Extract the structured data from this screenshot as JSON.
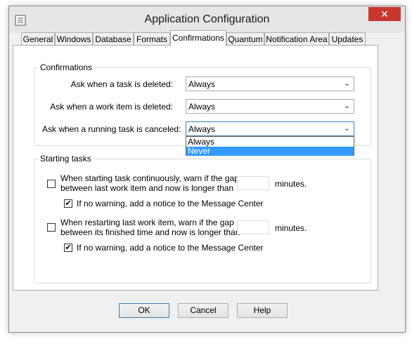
{
  "window": {
    "title": "Application Configuration",
    "close_glyph": "✕"
  },
  "tabs": [
    {
      "label": "General"
    },
    {
      "label": "Windows"
    },
    {
      "label": "Database"
    },
    {
      "label": "Formats"
    },
    {
      "label": "Confirmations",
      "active": true
    },
    {
      "label": "Quantum"
    },
    {
      "label": "Notification Area"
    },
    {
      "label": "Updates"
    }
  ],
  "confirmations": {
    "group_title": "Confirmations",
    "rows": [
      {
        "label": "Ask when a task is deleted:",
        "value": "Always"
      },
      {
        "label": "Ask when a work item is deleted:",
        "value": "Always"
      },
      {
        "label": "Ask when a running task is canceled:",
        "value": "Always"
      }
    ],
    "dropdown_options": [
      "Always",
      "Never"
    ],
    "dropdown_highlighted": "Never"
  },
  "starting_tasks": {
    "group_title": "Starting tasks",
    "warn_continuous": {
      "line1": "When starting task continuously, warn if the gap",
      "line2": "between last work item and now is longer than",
      "checked": false,
      "value": "",
      "unit": "minutes."
    },
    "notice_continuous": {
      "label": "If no warning, add a notice to the Message Center",
      "checked": true
    },
    "warn_restart": {
      "line1": "When restarting last work item, warn if the gap",
      "line2": "between its finished time and now is longer than",
      "checked": false,
      "value": "",
      "unit": "minutes."
    },
    "notice_restart": {
      "label": "If no warning, add a notice to the Message Center",
      "checked": true
    }
  },
  "buttons": {
    "ok": "OK",
    "cancel": "Cancel",
    "help": "Help"
  },
  "glyphs": {
    "check": "✔",
    "arrow": "⌄"
  },
  "colors": {
    "close": "#c7372f",
    "selection": "#3399ff",
    "focus": "#3c7fb1"
  }
}
